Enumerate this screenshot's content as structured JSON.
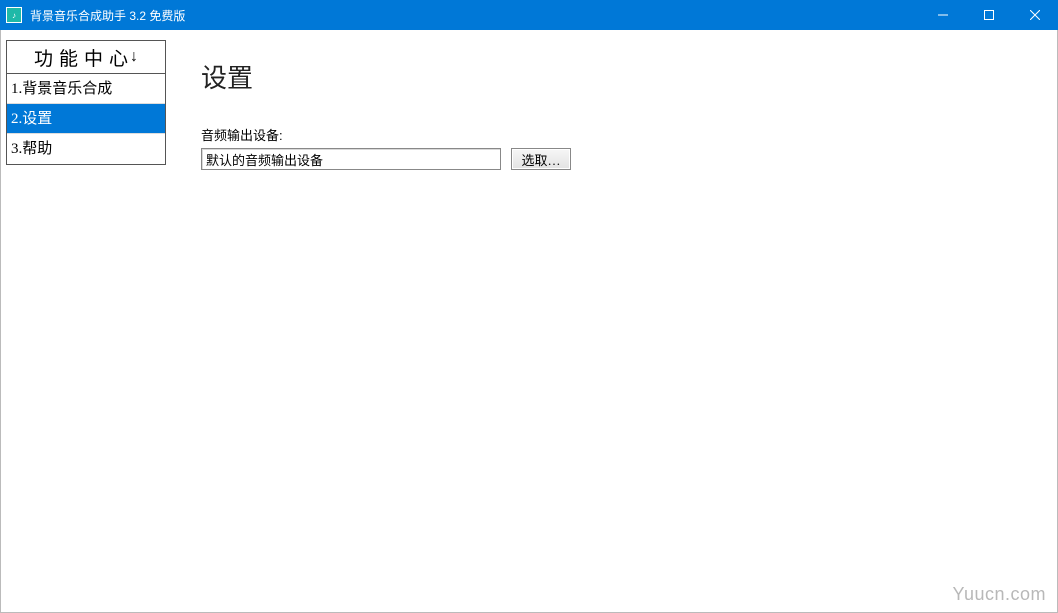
{
  "window": {
    "title": "背景音乐合成助手 3.2 免费版"
  },
  "sidebar": {
    "header": "功能中心",
    "header_arrow": "↓",
    "items": [
      {
        "label": "1.背景音乐合成",
        "selected": false
      },
      {
        "label": "2.设置",
        "selected": true
      },
      {
        "label": "3.帮助",
        "selected": false
      }
    ]
  },
  "main": {
    "title": "设置",
    "audio_output_label": "音频输出设备:",
    "audio_output_value": "默认的音频输出设备",
    "select_button": "选取…"
  },
  "watermark": "Yuucn.com"
}
